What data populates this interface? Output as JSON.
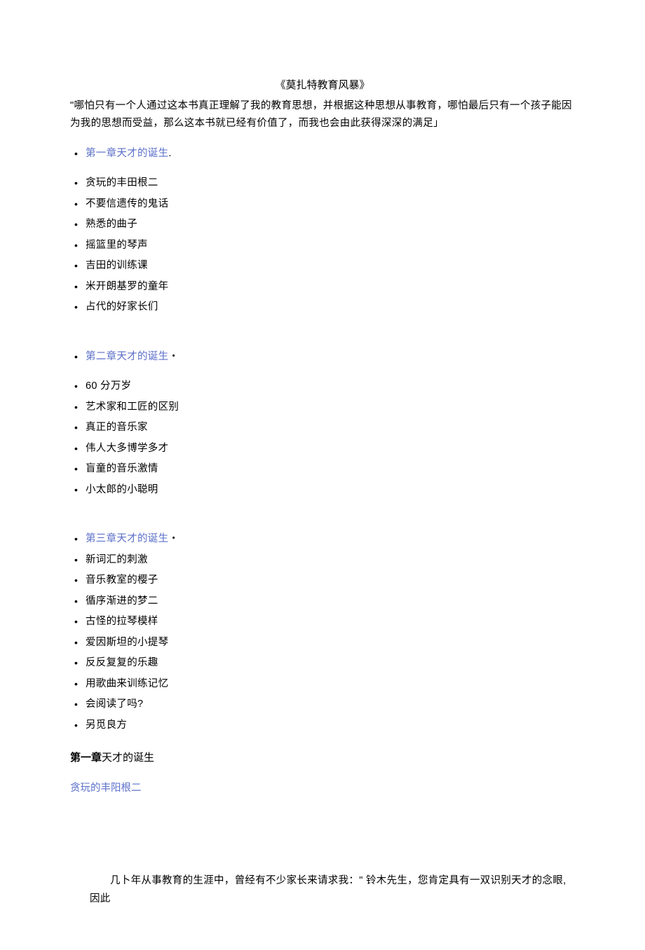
{
  "title": "《莫扎特教育风暴》",
  "intro": "\"哪怕只有一个人通过这本书真正理解了我的教育思想，并根据这种思想从事教育，哪怕最后只有一个孩子能因为我的思想而受益，那么这本书就已经有价值了，而我也会由此获得深深的满足」",
  "chapter1": {
    "link": "第一章天才的诞生",
    "tail": ".",
    "items": [
      "贪玩的丰田根二",
      "不要信遗传的鬼话",
      "熟悉的曲子",
      "摇篮里的琴声",
      "吉田的训练课",
      "米开朗基罗的童年",
      "占代的好家长们"
    ]
  },
  "chapter2": {
    "link": "第二章天才的诞生",
    "tail": "・",
    "items": [
      "60 分万岁",
      "艺术家和工匠的区别",
      "真正的音乐家",
      "伟人大多博学多才",
      "盲童的音乐激情",
      "小太郎的小聪明"
    ]
  },
  "chapter3": {
    "link": "第三章天才的诞生",
    "tail": "・",
    "items": [
      "新词汇的刺激",
      "音乐教室的樱子",
      "循序渐进的梦二",
      "古怪的拉琴模样",
      "爱因斯坦的小提琴",
      "反反复复的乐趣",
      "用歌曲来训练记忆",
      "会阅读了吗?",
      "另觅良方"
    ]
  },
  "sectionHeading": {
    "boldPrefix": "第一章",
    "rest": "天才的诞生"
  },
  "subLink": "贪玩的丰阳根二",
  "bodyText": "几卜年从事教育的生涯中，曾经有不少家长来请求我：\" 铃木先生，您肯定具有一双识别天才的念眼,因此"
}
